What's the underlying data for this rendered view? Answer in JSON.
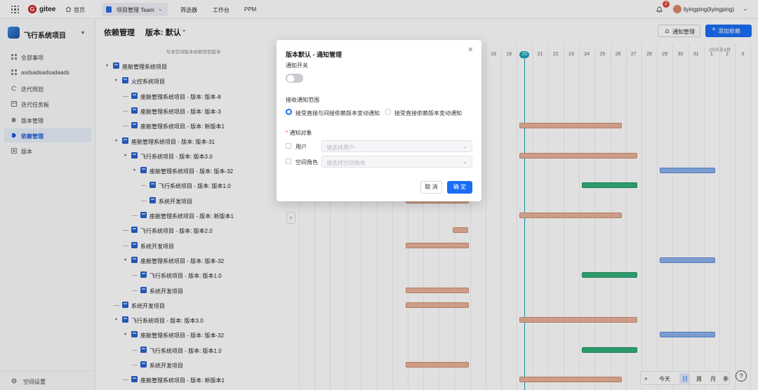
{
  "topbar": {
    "brand": "gitee",
    "home": "首页",
    "team": "项目管理 Team",
    "nav": [
      "筛选器",
      "工作台",
      "PPM"
    ],
    "notification_count": "2",
    "username": "liyingping(liyingping)"
  },
  "sidebar": {
    "project_name": "飞行系统项目",
    "items": [
      {
        "label": "全部事项",
        "icon": "grid-icon"
      },
      {
        "label": "asdsadsadsadaads",
        "icon": "grid-icon"
      },
      {
        "label": "迭代规划",
        "icon": "cycle-icon"
      },
      {
        "label": "迭代任务板",
        "icon": "board-icon"
      },
      {
        "label": "版本管理",
        "icon": "version-icon"
      },
      {
        "label": "依赖管理",
        "icon": "dependency-icon",
        "active": true
      },
      {
        "label": "版本",
        "icon": "version-list-icon"
      }
    ],
    "settings": "空间设置"
  },
  "header": {
    "title": "依赖管理",
    "version": "版本: 默认",
    "notify_button": "通知管理",
    "add_button": "添加依赖"
  },
  "tree": {
    "column_header": "与本空间版本依赖项目版本",
    "rows": [
      {
        "label": "座舱管理系统项目",
        "depth": 0,
        "caret": true
      },
      {
        "label": "火控系统项目",
        "depth": 1,
        "caret": true
      },
      {
        "label": "座舱管理系统项目 - 版本: 版本-8",
        "depth": 2,
        "caret": false
      },
      {
        "label": "座舱管理系统项目 - 版本: 版本-3",
        "depth": 2,
        "caret": false
      },
      {
        "label": "座舱管理系统项目 - 版本: 新版本1",
        "depth": 2,
        "caret": false
      },
      {
        "label": "座舱管理系统项目 - 版本: 版本-31",
        "depth": 1,
        "caret": true
      },
      {
        "label": "飞行系统项目 - 版本: 版本3.0",
        "depth": 2,
        "caret": true
      },
      {
        "label": "座舱管理系统项目 - 版本: 版本-32",
        "depth": 3,
        "caret": true
      },
      {
        "label": "飞行系统项目 - 版本: 版本1.0",
        "depth": 4,
        "caret": false
      },
      {
        "label": "系统开发项目",
        "depth": 4,
        "caret": false
      },
      {
        "label": "座舱管理系统项目 - 版本: 新版本1",
        "depth": 3,
        "caret": false
      },
      {
        "label": "飞行系统项目 - 版本: 版本2.0",
        "depth": 2,
        "caret": false
      },
      {
        "label": "系统开发项目",
        "depth": 2,
        "caret": false
      },
      {
        "label": "座舱管理系统项目 - 版本: 版本-32",
        "depth": 2,
        "caret": true
      },
      {
        "label": "飞行系统项目 - 版本: 版本1.0",
        "depth": 3,
        "caret": false
      },
      {
        "label": "系统开发项目",
        "depth": 3,
        "caret": false
      },
      {
        "label": "系统开发项目",
        "depth": 1,
        "caret": false
      },
      {
        "label": "飞行系统项目 - 版本: 版本3.0",
        "depth": 1,
        "caret": true
      },
      {
        "label": "座舱管理系统项目 - 版本: 版本-32",
        "depth": 2,
        "caret": true
      },
      {
        "label": "飞行系统项目 - 版本: 版本1.0",
        "depth": 3,
        "caret": false
      },
      {
        "label": "系统开发项目",
        "depth": 3,
        "caret": false
      },
      {
        "label": "座舱管理系统项目 - 版本: 新版本1",
        "depth": 2,
        "caret": false
      }
    ]
  },
  "gantt": {
    "month_label": "2025年4月",
    "days": [
      "18",
      "19",
      "20",
      "21",
      "22",
      "23",
      "24",
      "25",
      "26",
      "27",
      "28",
      "29",
      "30",
      "31",
      "1",
      "2",
      "3"
    ],
    "today": "20",
    "bars": [
      {
        "row": 4,
        "start": "20",
        "end": "26",
        "color": "salmon"
      },
      {
        "row": 6,
        "start": "20",
        "end": "27",
        "color": "salmon"
      },
      {
        "row": 7,
        "start": "29",
        "end": "1",
        "color": "blue"
      },
      {
        "row": 8,
        "start": "24",
        "end": "27",
        "color": "green"
      },
      {
        "row": 10,
        "start": "20",
        "end": "26",
        "color": "salmon"
      },
      {
        "row": 13,
        "start": "29",
        "end": "1",
        "color": "blue"
      },
      {
        "row": 14,
        "start": "24",
        "end": "27",
        "color": "green"
      },
      {
        "row": 17,
        "start": "20",
        "end": "27",
        "color": "salmon"
      },
      {
        "row": 18,
        "start": "29",
        "end": "1",
        "color": "blue"
      },
      {
        "row": 19,
        "start": "24",
        "end": "27",
        "color": "green"
      },
      {
        "row": 21,
        "start": "20",
        "end": "26",
        "color": "salmon"
      }
    ]
  },
  "modal": {
    "title": "版本默认 - 通知管理",
    "switch_label": "通知开关",
    "switch_on": false,
    "scope_label": "接收通知范围",
    "scope_options": [
      "接受直接与间接依赖版本变动通知",
      "接受直接依赖版本变动通知"
    ],
    "scope_selected": 0,
    "target_label": "通知对象",
    "target_required_mark": "*",
    "user_label": "用户",
    "user_placeholder": "请选择用户",
    "role_label": "空间角色",
    "role_placeholder": "请选择空间角色",
    "cancel": "取 消",
    "ok": "确 定"
  },
  "view_switcher": {
    "expand": "»",
    "today": "今天",
    "modes": [
      "日",
      "周",
      "月",
      "季"
    ],
    "active": "日",
    "help": "?"
  },
  "colors": {
    "primary": "#1b6ef3",
    "today": "#14a3b7",
    "bar_salmon": "#e8b39c",
    "bar_blue": "#8db2eb",
    "bar_green": "#34b07a"
  }
}
